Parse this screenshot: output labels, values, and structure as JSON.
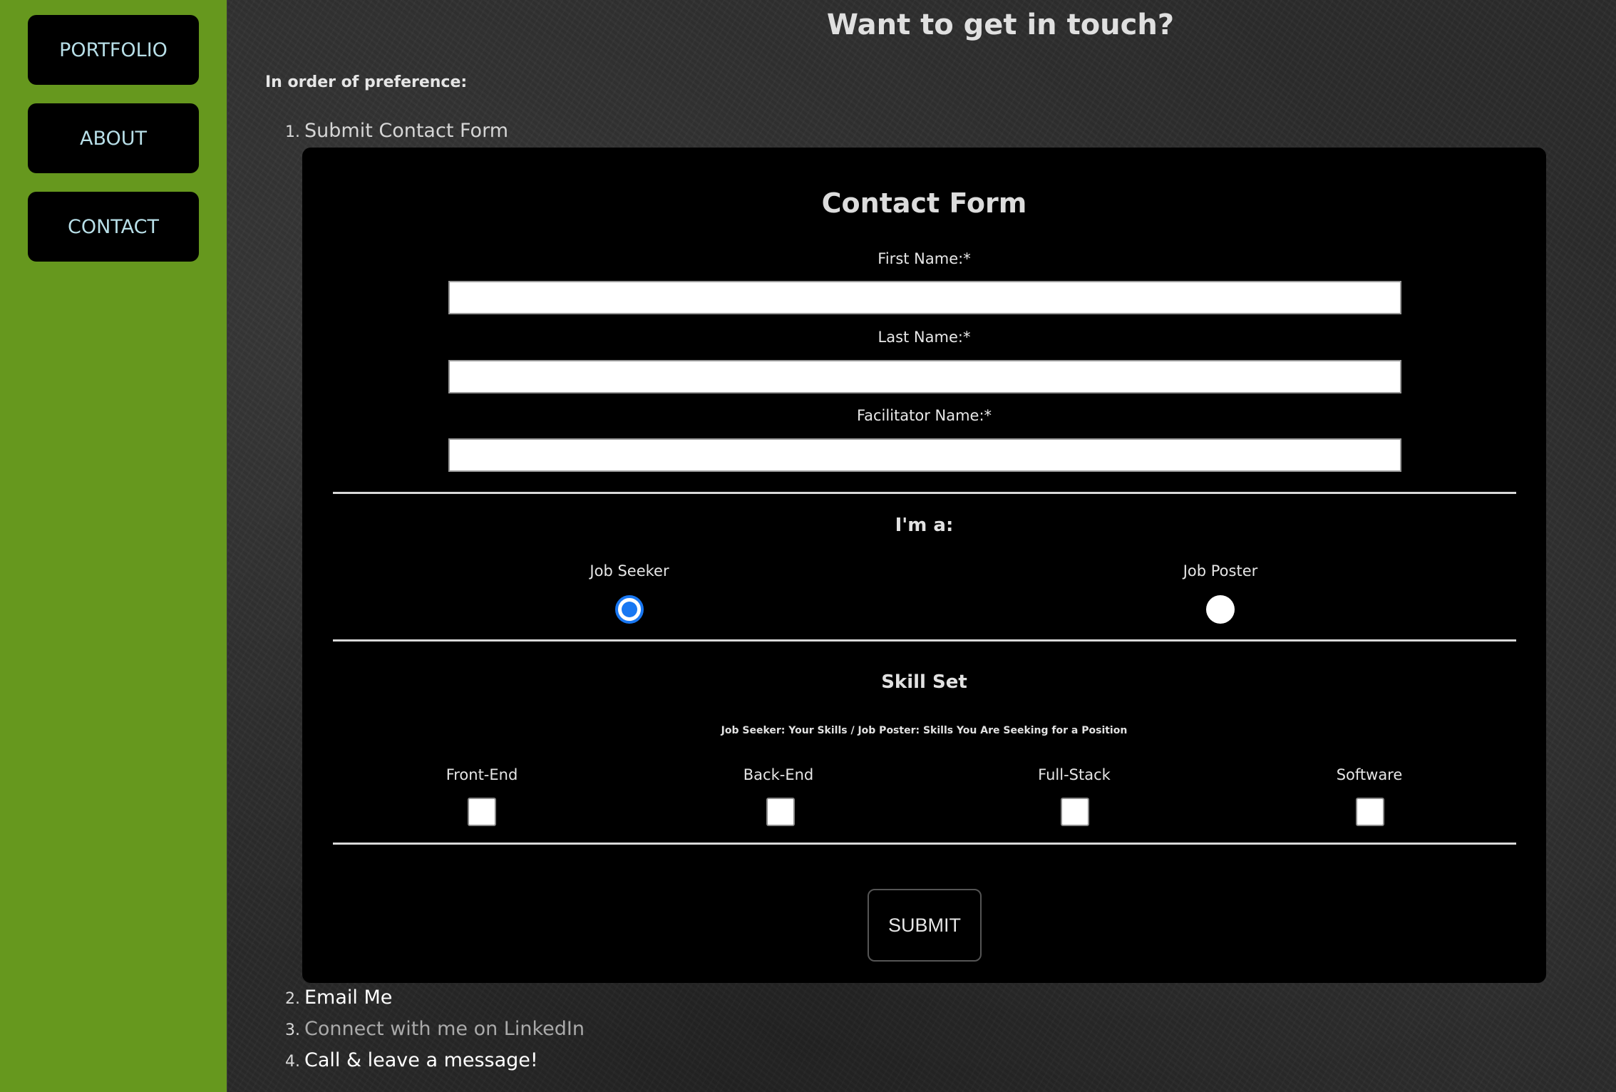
{
  "sidebar": {
    "items": [
      {
        "label": "PORTFOLIO"
      },
      {
        "label": "ABOUT"
      },
      {
        "label": "CONTACT"
      }
    ]
  },
  "main": {
    "title": "Want to get in touch?",
    "preference_label": "In order of preference:",
    "list": [
      {
        "number": "1.",
        "label": "Submit Contact Form"
      },
      {
        "number": "2.",
        "label": "Email Me"
      },
      {
        "number": "3.",
        "label": "Connect with me on LinkedIn"
      },
      {
        "number": "4.",
        "label": "Call & leave a message!"
      }
    ]
  },
  "form": {
    "heading": "Contact Form",
    "fields": [
      {
        "label": "First Name:*",
        "value": ""
      },
      {
        "label": "Last Name:*",
        "value": ""
      },
      {
        "label": "Facilitator Name:*",
        "value": ""
      }
    ],
    "role": {
      "title": "I'm a:",
      "options": [
        {
          "label": "Job Seeker",
          "checked": true
        },
        {
          "label": "Job Poster",
          "checked": false
        }
      ]
    },
    "skills": {
      "title": "Skill Set",
      "note": "Job Seeker: Your Skills / Job Poster: Skills You Are Seeking for a Position",
      "options": [
        {
          "label": "Front-End",
          "checked": false
        },
        {
          "label": "Back-End",
          "checked": false
        },
        {
          "label": "Full-Stack",
          "checked": false
        },
        {
          "label": "Software",
          "checked": false
        }
      ]
    },
    "submit_label": "SUBMIT"
  },
  "colors": {
    "sidebar_bg": "#66981e",
    "nav_text": "#b8dfe8",
    "radio_accent": "#1877f2"
  }
}
